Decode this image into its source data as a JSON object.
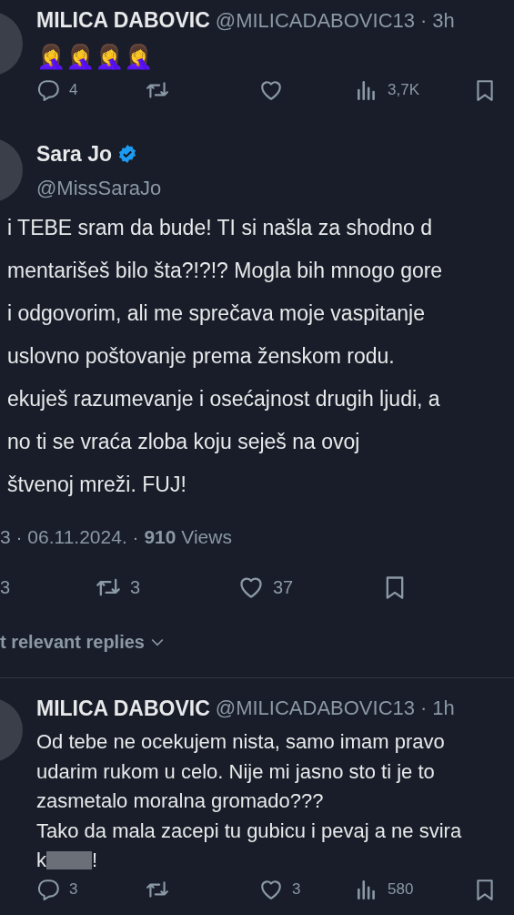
{
  "top_tweet": {
    "name": "MILICA DABOVIC",
    "handle": "@MILICADABOVIC13",
    "separator": "·",
    "time": "3h",
    "text": "🤦‍♀️🤦‍♀️🤦‍♀️🤦‍♀️",
    "actions": [
      {
        "kind": "reply",
        "count": "4"
      },
      {
        "kind": "retweet"
      },
      {
        "kind": "like"
      },
      {
        "kind": "views",
        "count": "3,7K"
      },
      {
        "kind": "bookmark"
      }
    ]
  },
  "main_tweet": {
    "name": "Sara Jo",
    "verified": true,
    "handle": "@MissSaraJo",
    "lines": [
      "i TEBE sram da bude! TI si našla za shodno d",
      "mentarišeš bilo šta?!?!? Mogla bih mnogo gore",
      "i odgovorim, ali me sprečava moje vaspitanje",
      "uslovno poštovanje prema ženskom rodu.",
      "ekuješ razumevanje i osećajnost drugih ljudi, a",
      "no ti se vraća zloba koju seješ na ovoj",
      "štvenoj mreži. FUJ!"
    ],
    "meta": "3 · 06.11.2024. · **910** Views",
    "actions": [
      {
        "kind": "count",
        "count": "3"
      },
      {
        "kind": "retweet",
        "count": "3"
      },
      {
        "kind": "like",
        "count": "37"
      },
      {
        "kind": "bookmark"
      }
    ]
  },
  "replies_sort": "t relevant replies",
  "reply": {
    "name": "MILICA DABOVIC",
    "handle": "@MILICADABOVIC13",
    "separator": "·",
    "time": "1h",
    "lines": [
      "Od tebe ne ocekujem nista, samo imam pravo",
      "udarim rukom u celo. Nije mi jasno sto ti je to",
      "zasmetalo moralna gromado???",
      "Tako da mala zacepi tu gubicu i pevaj a ne svira"
    ],
    "censored_line": {
      "before": "k",
      "after": "!"
    },
    "actions": [
      {
        "kind": "reply",
        "count": "3"
      },
      {
        "kind": "retweet"
      },
      {
        "kind": "like",
        "count": "3"
      },
      {
        "kind": "views",
        "count": "580"
      },
      {
        "kind": "bookmark"
      }
    ]
  }
}
